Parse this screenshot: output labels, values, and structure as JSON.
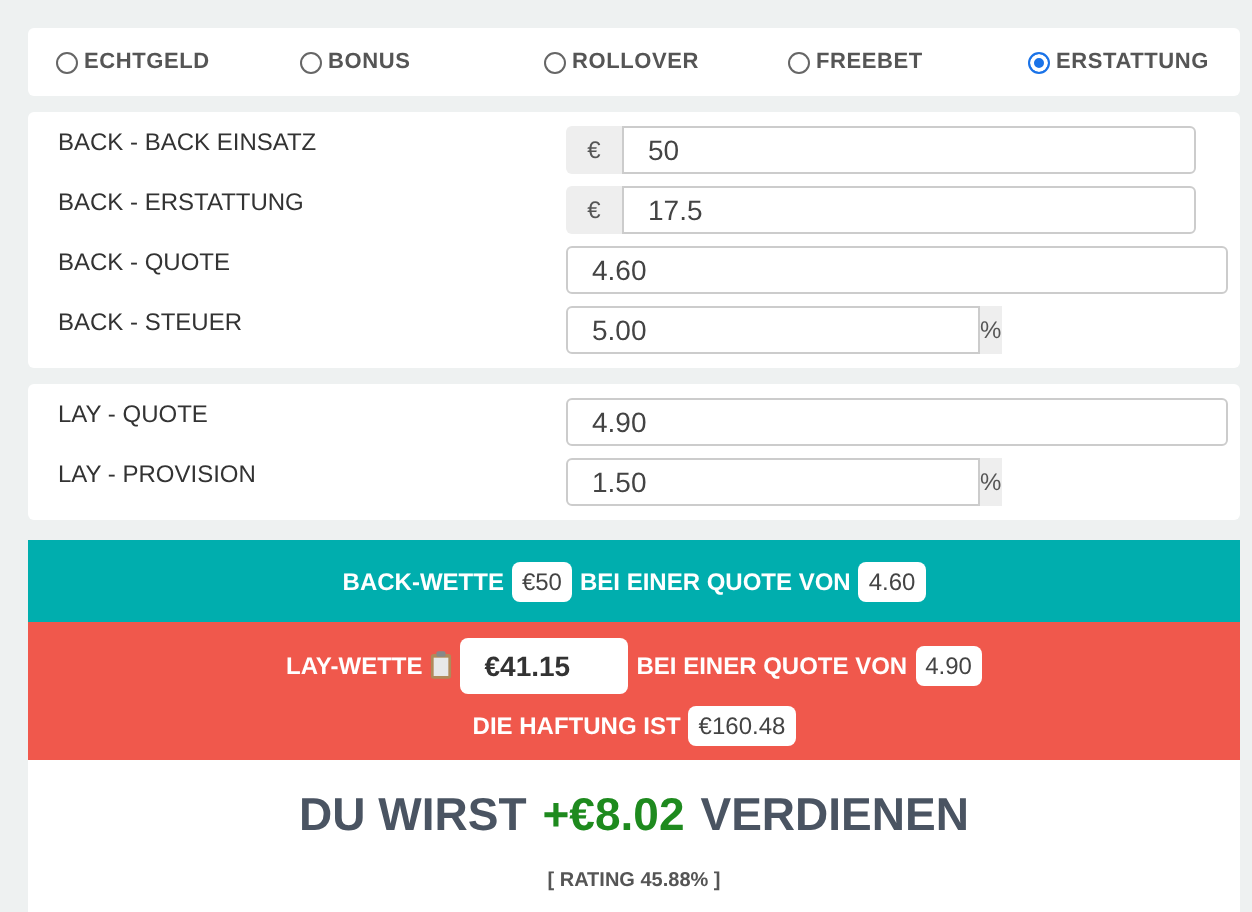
{
  "modes": [
    {
      "label": "ECHTGELD",
      "selected": false
    },
    {
      "label": "BONUS",
      "selected": false
    },
    {
      "label": "ROLLOVER",
      "selected": false
    },
    {
      "label": "FREEBET",
      "selected": false
    },
    {
      "label": "ERSTATTUNG",
      "selected": true
    }
  ],
  "back_fields": [
    {
      "label": "BACK - BACK EINSATZ",
      "kind": "prefix",
      "addon": "€",
      "value": "50"
    },
    {
      "label": "BACK - ERSTATTUNG",
      "kind": "prefix",
      "addon": "€",
      "value": "17.5"
    },
    {
      "label": "BACK - QUOTE",
      "kind": "plain",
      "value": "4.60"
    },
    {
      "label": "BACK - STEUER",
      "kind": "suffix",
      "addon": "%",
      "value": "5.00"
    }
  ],
  "lay_fields": [
    {
      "label": "LAY - QUOTE",
      "kind": "plain",
      "value": "4.90"
    },
    {
      "label": "LAY - PROVISION",
      "kind": "suffix",
      "addon": "%",
      "value": "1.50"
    }
  ],
  "back_bet": {
    "label": "BACK-WETTE",
    "stake": "€50",
    "odds_label": "BEI EINER QUOTE VON",
    "odds": "4.60"
  },
  "lay_bet": {
    "label": "LAY-WETTE",
    "stake": "€41.15",
    "odds_label": "BEI EINER QUOTE VON",
    "odds": "4.90",
    "liability_label": "DIE HAFTUNG IST",
    "liability": "€160.48"
  },
  "result": {
    "prefix": "DU WIRST",
    "amount": "+€8.02",
    "suffix": "VERDIENEN",
    "rating": "[ RATING 45.88% ]"
  }
}
